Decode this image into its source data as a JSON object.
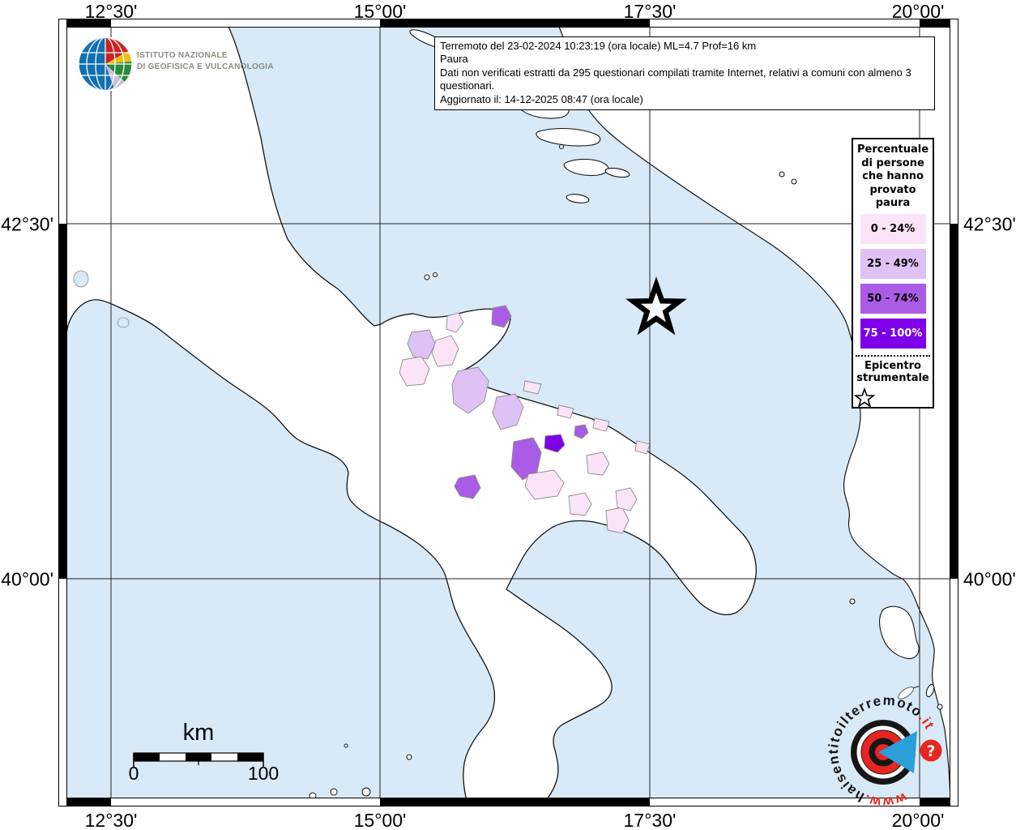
{
  "title_box": {
    "line1": "Terremoto del 23-02-2024 10:23:19 (ora locale) ML=4.7 Prof=16 km",
    "line2": "Paura",
    "line3": "Dati non verificati estratti da 295 questionari compilati tramite Internet, relativi a comuni con almeno 3 questionari.",
    "line4": "Aggiornato il: 14-12-2025 08:47 (ora locale)"
  },
  "legend": {
    "title": "Percentuale di persone che hanno provato paura",
    "items": [
      {
        "label": "0 - 24%",
        "color": "#fbe4f8",
        "text_color": "#000000"
      },
      {
        "label": "25 - 49%",
        "color": "#dfc2f5",
        "text_color": "#000000"
      },
      {
        "label": "50 - 74%",
        "color": "#ab5ce6",
        "text_color": "#000000"
      },
      {
        "label": "75 - 100%",
        "color": "#7d00e8",
        "text_color": "#ffffff"
      }
    ],
    "epicenter_label": "Epicentro strumentale"
  },
  "axes": {
    "top": [
      "12°30'",
      "15°00'",
      "17°30'",
      "20°00'"
    ],
    "bottom": [
      "12°30'",
      "15°00'",
      "17°30'",
      "20°00'"
    ],
    "left": [
      "42°30'",
      "40°00'"
    ],
    "right": [
      "42°30'",
      "40°00'"
    ]
  },
  "scale_bar": {
    "unit": "km",
    "start": "0",
    "end": "100"
  },
  "ingv_logo": {
    "line1": "ISTITUTO NAZIONALE",
    "line2": "DI GEOFISICA E VULCANOLOGIA"
  },
  "watermark": {
    "url_prefix": "www.",
    "url_body": "haisentitoil",
    "url_brand": "terremoto",
    "url_tld": ".it",
    "question_mark": "?",
    "red": "#e8251f",
    "blue": "#2b9fd9"
  },
  "map": {
    "sea_color": "#d8eaf7",
    "land_color": "#ffffff",
    "municipality_line_color": "#b5b5b5",
    "coast_color": "#141414",
    "grid_color": "#222222"
  }
}
